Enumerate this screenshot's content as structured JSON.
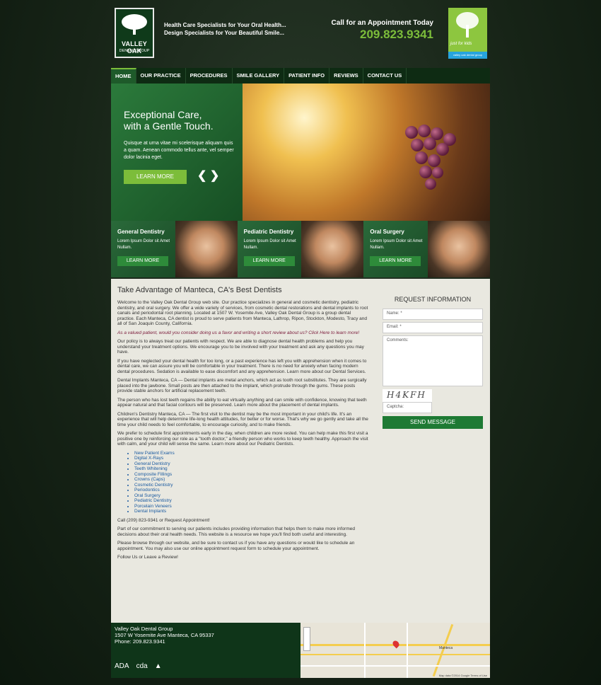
{
  "header": {
    "logo_line1": "VALLEY OAK",
    "logo_line2": "DENTAL GROUP",
    "tagline1": "Health Care Specialists for Your Oral Health...",
    "tagline2": "Design Specialists for Your Beautiful Smile...",
    "call_label": "Call for an Appointment Today",
    "phone": "209.823.9341",
    "kids_text": "just for kids",
    "kids_sub": "valley oak dental group"
  },
  "nav": [
    "HOME",
    "OUR PRACTICE",
    "PROCEDURES",
    "SMILE GALLERY",
    "PATIENT INFO",
    "REVIEWS",
    "CONTACT US"
  ],
  "hero": {
    "title_line1": "Exceptional Care,",
    "title_line2": "with a Gentle Touch.",
    "text": "Quisque at urna vitae mi scelerisque aliquam quis a quam. Aenean commodo tellus ante, vel semper dolor lacinia eget.",
    "button": "LEARN MORE",
    "prev": "❮",
    "next": "❯"
  },
  "tiles": [
    {
      "title": "General Dentistry",
      "desc": "Lorem Ipsum Dolor sit Amet Nullam.",
      "button": "LEARN MORE"
    },
    {
      "title": "Pediatric Dentistry",
      "desc": "Lorem Ipsum Dolor sit Amet Nullam.",
      "button": "LEARN MORE"
    },
    {
      "title": "Oral Surgery",
      "desc": "Lorem Ipsum Dolor sit Amet Nullam.",
      "button": "LEARN MORE"
    }
  ],
  "main": {
    "title": "Take Advantage of Manteca, CA's Best Dentists",
    "p1": "Welcome to the Valley Oak Dental Group web site. Our practice specializes in general and cosmetic dentistry, pediatric dentistry, and oral surgery. We offer a wide variety of services, from cosmetic dental restorations and dental implants to root canals and periodontal root planning. Located at 1507 W. Yosemite Ave, Valley Oak Dental Group is a group dental practice. Each Manteca, CA dentist is proud to serve patients from Manteca, Lathrop, Ripon, Stockton, Modesto, Tracy and all of San Joaquin County, California.",
    "review": "As a valued patient, would you consider doing us a favor and writing a short review about us? Click Here to learn more!",
    "p2": "Our policy is to always treat our patients with respect. We are able to diagnose dental health problems and help you understand your treatment options. We encourage you to be involved with your treatment and ask any questions you may have.",
    "p3": "If you have neglected your dental health for too long, or a past experience has left you with apprehension when it comes to dental care, we can assure you will be comfortable in your treatment. There is no need for anxiety when facing modern dental procedures. Sedation is available to ease discomfort and any apprehension. Learn more about our Dental Services.",
    "p4": "Dental Implants Manteca, CA — Dental implants are metal anchors, which act as tooth root substitutes. They are surgically placed into the jawbone. Small posts are then attached to the implant, which protrude through the gums. These posts provide stable anchors for artificial replacement teeth.",
    "p5": "The person who has lost teeth regains the ability to eat virtually anything and can smile with confidence, knowing that teeth appear natural and that facial contours will be preserved. Learn more about the placement of dental implants.",
    "p6": "Children's Dentistry Manteca, CA — The first visit to the dentist may be the most important in your child's life. It's an experience that will help determine life-long health attitudes, for better or for worse. That's why we go gently and take all the time your child needs to feel comfortable, to encourage curiosity, and to make friends.",
    "p7": "We prefer to schedule first appointments early in the day, when children are more rested. You can help make this first visit a positive one by reinforcing our role as a \"tooth doctor,\" a friendly person who works to keep teeth healthy. Approach the visit with calm, and your child will sense the same. Learn more about our Pediatric Dentists.",
    "links": [
      "New Patient Exams",
      "Digital X-Rays",
      "General Dentistry",
      "Teeth Whitening",
      "Composite Fillings",
      "Crowns (Caps)",
      "Cosmetic Dentistry",
      "Periodontics",
      "Oral Surgery",
      "Pediatric Dentistry",
      "Porcelain Veneers",
      "Dental Implants"
    ],
    "call": "Call (209) 823-9341 or Request Appointment!",
    "p8": "Part of our commitment to serving our patients includes providing information that helps them to make more informed decisions about their oral health needs. This website is a resource we hope you'll find both useful and interesting.",
    "p9": "Please browse through our website, and be sure to contact us if you have any questions or would like to schedule an appointment. You may also use our online appointment request form to schedule your appointment.",
    "p10": "Follow Us or Leave a Review!"
  },
  "form": {
    "title": "REQUEST INFORMATION",
    "name_ph": "Name: *",
    "email_ph": "Email: *",
    "comments_ph": "Comments:",
    "captcha_img": "H4KFH",
    "captcha_ph": "Captcha:",
    "send": "SEND MESSAGE"
  },
  "footer": {
    "name": "Valley Oak Dental Group",
    "address": "1507 W Yosemite Ave Manteca, CA 95337",
    "phone": "Phone: 209.823.9341",
    "badge1": "ADA",
    "badge2": "cda",
    "map_city": "Manteca",
    "map_data": "Map data ©2014 Google   Terms of Use"
  }
}
